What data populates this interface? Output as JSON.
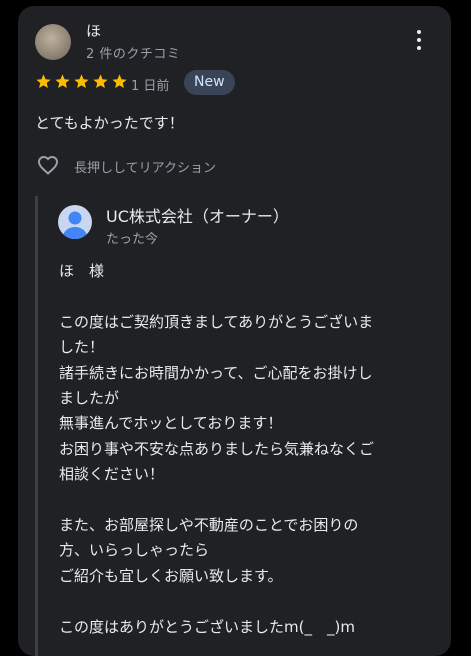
{
  "review": {
    "reviewer_name": "ほ",
    "review_count": "2 件のクチコミ",
    "rating": 5,
    "max_rating": 5,
    "date": "1 日前",
    "badge": "New",
    "text": "とてもよかったです！",
    "like_hint": "長押ししてリアクション"
  },
  "reply": {
    "owner_name": "UC株式会社（オーナー）",
    "time": "たった今",
    "lines": [
      "ほ　様",
      "",
      "この度はご契約頂きましてありがとうございま",
      "した！",
      "諸手続きにお時間かかって、ご心配をお掛けし",
      "ましたが",
      "無事進んでホッとしております！",
      "お困り事や不安な点ありましたら気兼ねなくご",
      "相談ください！",
      "",
      "また、お部屋探しや不動産のことでお困りの",
      "方、いらっしゃったら",
      "ご紹介も宜しくお願い致します。",
      "",
      "この度はありがとうございましたm(_　_)m"
    ]
  },
  "colors": {
    "star": "#fbbc04",
    "card": "#202124",
    "badge_bg": "#394457"
  },
  "icons": {
    "more": "more-vert-icon",
    "star": "star-icon",
    "heart": "heart-outline-icon",
    "owner": "person-icon"
  }
}
